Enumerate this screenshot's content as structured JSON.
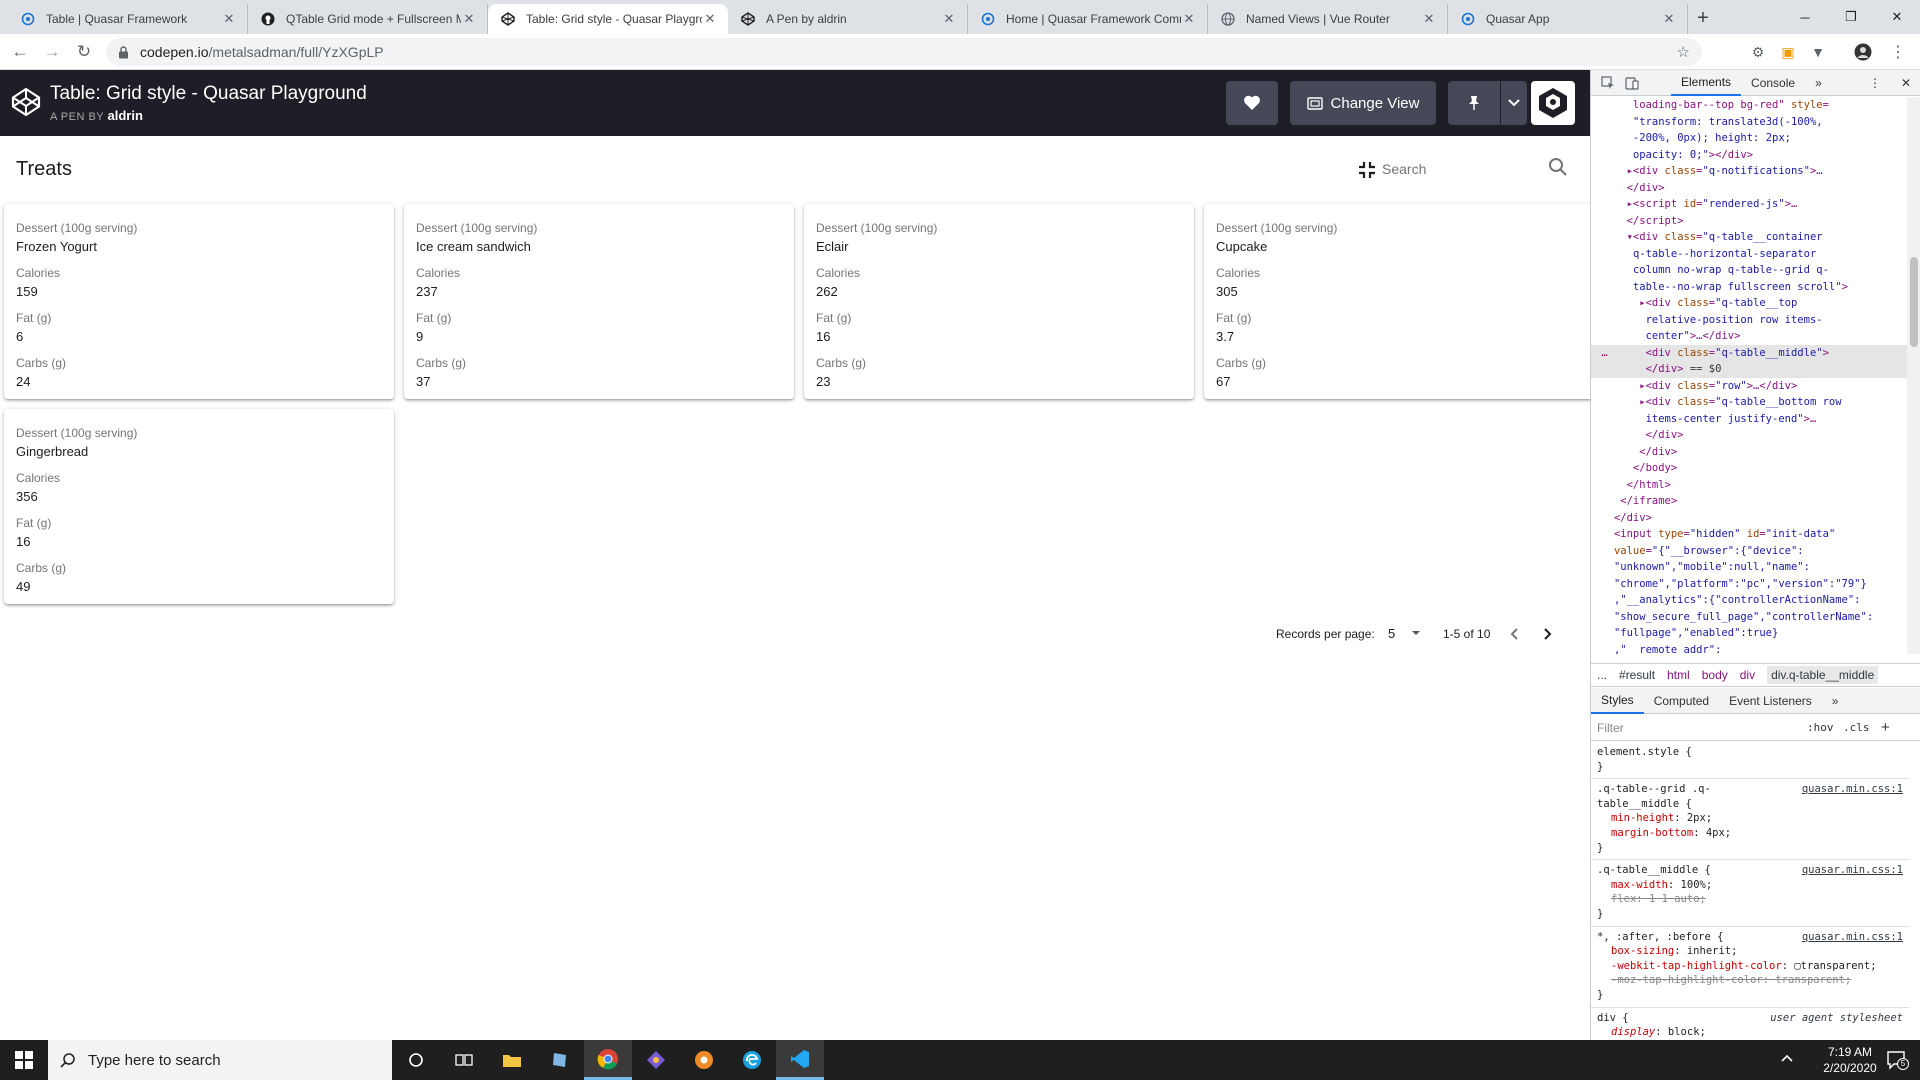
{
  "browser": {
    "tabs": [
      {
        "title": "Table | Quasar Framework",
        "favicon": "quasar-icon",
        "active": false
      },
      {
        "title": "QTable Grid mode + Fullscreen M",
        "favicon": "github-icon",
        "active": false
      },
      {
        "title": "Table: Grid style - Quasar Playgro",
        "favicon": "codepen-icon",
        "active": true
      },
      {
        "title": "A Pen by aldrin",
        "favicon": "codepen-icon",
        "active": false
      },
      {
        "title": "Home | Quasar Framework Comm",
        "favicon": "quasar-icon",
        "active": false
      },
      {
        "title": "Named Views | Vue Router",
        "favicon": "globe-icon",
        "active": false
      },
      {
        "title": "Quasar App",
        "favicon": "quasar-icon",
        "active": false
      }
    ],
    "url_host": "codepen.io",
    "url_path": "/metalsadman/full/YzXGpLP"
  },
  "codepen": {
    "title": "Table: Grid style - Quasar Playground",
    "by_prefix": "A PEN BY",
    "author": "aldrin",
    "change_view_label": "Change View"
  },
  "table": {
    "title": "Treats",
    "search_placeholder": "Search",
    "columns": [
      "Dessert (100g serving)",
      "Calories",
      "Fat (g)",
      "Carbs (g)"
    ],
    "rows": [
      [
        "Frozen Yogurt",
        "159",
        "6",
        "24"
      ],
      [
        "Ice cream sandwich",
        "237",
        "9",
        "37"
      ],
      [
        "Eclair",
        "262",
        "16",
        "23"
      ],
      [
        "Cupcake",
        "305",
        "3.7",
        "67"
      ],
      [
        "Gingerbread",
        "356",
        "16",
        "49"
      ]
    ],
    "pagination": {
      "records_label": "Records per page:",
      "per_page": "5",
      "range": "1-5 of 10"
    }
  },
  "devtools": {
    "tabs": [
      "Elements",
      "Console"
    ],
    "more_tabs": "»",
    "breadcrumbs": [
      "...",
      "#result",
      "html",
      "body",
      "div",
      "div.q-table__middle"
    ],
    "styles_tabs": [
      "Styles",
      "Computed",
      "Event Listeners"
    ],
    "filter_placeholder": "Filter",
    "hov": ":hov",
    "cls": ".cls"
  },
  "taskbar": {
    "search_placeholder": "Type here to search",
    "time": "7:19 AM",
    "date": "2/20/2020",
    "notifications": "5"
  },
  "colors": {
    "codepen_header": "#1e1f26",
    "codepen_button": "#444857",
    "tab_strip": "#dee1e6",
    "taskbar": "#1f1f1f"
  }
}
